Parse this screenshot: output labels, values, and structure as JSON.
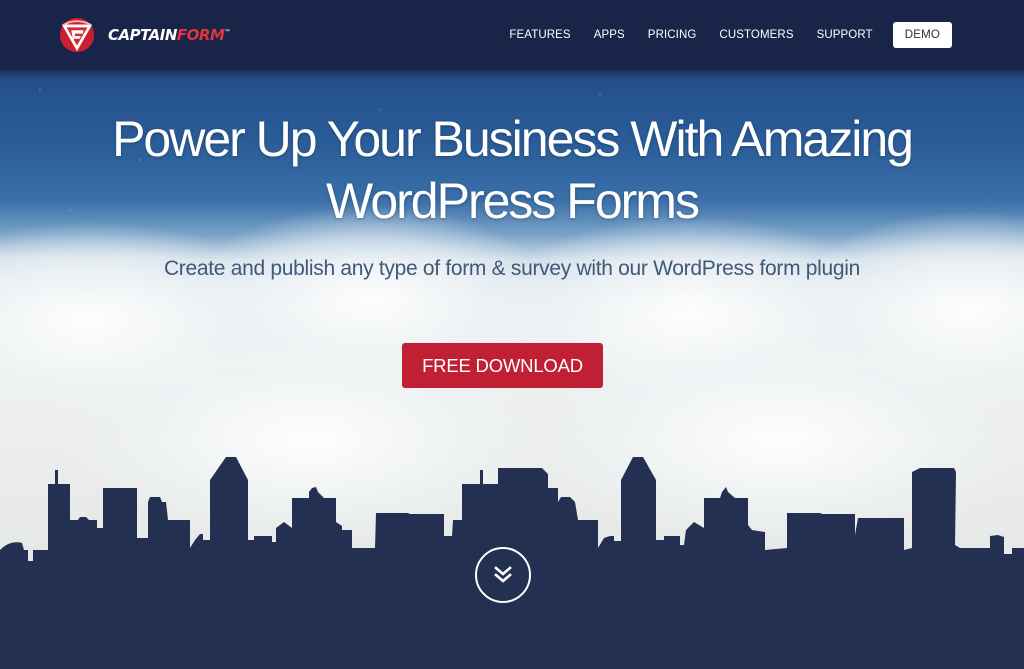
{
  "brand": {
    "name_part1": "CAPTAIN",
    "name_part2": "FORM",
    "trademark": "™",
    "colors": {
      "navy": "#1c2a52",
      "red": "#c11f33",
      "skyline": "#243052"
    }
  },
  "nav": {
    "items": [
      {
        "label": "FEATURES"
      },
      {
        "label": "APPS"
      },
      {
        "label": "PRICING"
      },
      {
        "label": "CUSTOMERS"
      },
      {
        "label": "SUPPORT"
      }
    ],
    "demo_label": "DEMO"
  },
  "hero": {
    "headline_line1": "Power Up Your Business With Amazing",
    "headline_line2": "WordPress Forms",
    "subheadline": "Create and publish any type of form & survey with our WordPress form plugin",
    "cta_label": "FREE DOWNLOAD",
    "scroll_icon": "double-chevron-down-icon"
  }
}
